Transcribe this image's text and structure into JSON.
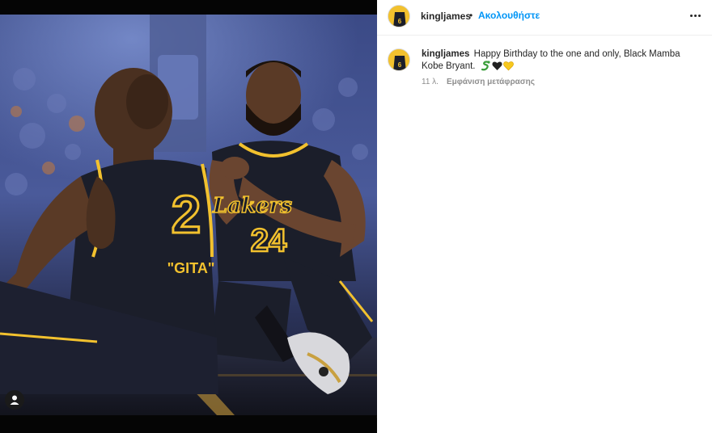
{
  "post": {
    "username": "kingljames",
    "separator": "•",
    "follow_label": "Ακολουθήστε",
    "more_icon": "more-horizontal-icon"
  },
  "photo": {
    "jersey_left_number": "2",
    "jersey_left_name": "\"GITA\"",
    "jersey_right_number": "24",
    "jersey_right_team": "Lakers"
  },
  "caption": {
    "username": "kingljames",
    "text": "Happy Birthday to the one and only, Black Mamba Kobe Bryant.",
    "emojis": [
      "snake-emoji",
      "black-heart-emoji",
      "yellow-heart-emoji"
    ],
    "time_ago": "11 λ.",
    "translate_label": "Εμφάνιση μετάφρασης"
  },
  "colors": {
    "link_blue": "#0095f6",
    "lakers_gold": "#f2c12e",
    "jersey_black": "#1b1e2a"
  },
  "misc": {
    "cursor_glyph": "("
  }
}
